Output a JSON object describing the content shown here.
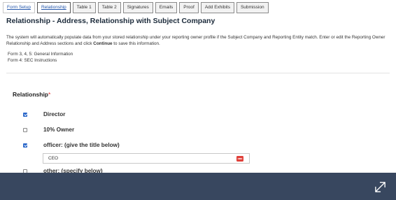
{
  "tabs": [
    {
      "label": "Form Setup",
      "state": "link"
    },
    {
      "label": "Relationship",
      "state": "active"
    },
    {
      "label": "Table 1",
      "state": "normal"
    },
    {
      "label": "Table 2",
      "state": "normal"
    },
    {
      "label": "Signatures",
      "state": "normal"
    },
    {
      "label": "Emails",
      "state": "normal"
    },
    {
      "label": "Proof",
      "state": "normal"
    },
    {
      "label": "Add Exhibits",
      "state": "normal"
    },
    {
      "label": "Submission",
      "state": "normal"
    }
  ],
  "heading": "Relationship - Address, Relationship with Subject Company",
  "description": {
    "text_before": "The system will automatically populate data from your stored relationship under your reporting owner profile if the Subject Company and Reporting Entity match. Enter or edit the Reporting Owner Relationship and Address sections and click ",
    "bold": "Continue",
    "text_after": " to save this information."
  },
  "form_links": {
    "line1": "Form 3, 4, 5: General Information",
    "line2": "Form 4: SEC Instructions"
  },
  "relationship": {
    "label": "Relationship",
    "required_mark": "*",
    "options": [
      {
        "label": "Director",
        "checked": true
      },
      {
        "label": "10% Owner",
        "checked": false
      },
      {
        "label": "officer: (give the title below)",
        "checked": true
      },
      {
        "label": "other: (specify below)",
        "checked": false
      }
    ],
    "officer_title_value": "CEO"
  },
  "icons": {
    "title_field_icon": "calendar-icon",
    "bottom_bar_icon": "expand-icon"
  },
  "colors": {
    "accent_blue": "#2a67c9",
    "required_red": "#e03030",
    "bottom_bar": "#38475f"
  }
}
